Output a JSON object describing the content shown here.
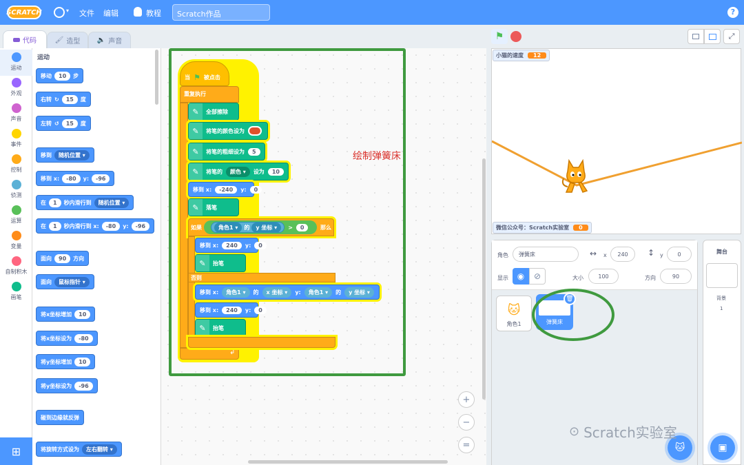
{
  "menu": {
    "logo": "SCRATCH",
    "file": "文件",
    "edit": "编辑",
    "tutorials": "教程",
    "project_title": "Scratch作品",
    "help": "?"
  },
  "tabs": {
    "code": "代码",
    "costumes": "造型",
    "sounds": "声音"
  },
  "categories": [
    {
      "label": "运动",
      "color": "#4c97ff"
    },
    {
      "label": "外观",
      "color": "#9966ff"
    },
    {
      "label": "声音",
      "color": "#cf63cf"
    },
    {
      "label": "事件",
      "color": "#ffd500"
    },
    {
      "label": "控制",
      "color": "#ffab19"
    },
    {
      "label": "侦测",
      "color": "#5cb1d6"
    },
    {
      "label": "运算",
      "color": "#59c059"
    },
    {
      "label": "变量",
      "color": "#ff8c1a"
    },
    {
      "label": "自制积木",
      "color": "#ff6680"
    },
    {
      "label": "画笔",
      "color": "#0fbd8c"
    }
  ],
  "palette": {
    "section": "运动",
    "move": {
      "pre": "移动",
      "val": "10",
      "post": "步"
    },
    "turn_right": {
      "pre": "右转",
      "val": "15",
      "post": "度"
    },
    "turn_left": {
      "pre": "左转",
      "val": "15",
      "post": "度"
    },
    "goto_random": {
      "pre": "移到",
      "drop": "随机位置"
    },
    "goto_xy": {
      "pre": "移到 x:",
      "x": "-80",
      "ylab": "y:",
      "y": "-96"
    },
    "glide_random": {
      "pre": "在",
      "val": "1",
      "mid": "秒内滑行到",
      "drop": "随机位置"
    },
    "glide_xy": {
      "pre": "在",
      "val": "1",
      "mid": "秒内滑行到 x:",
      "x": "-80",
      "ylab": "y:",
      "y": "-96"
    },
    "point_dir": {
      "pre": "面向",
      "val": "90",
      "post": "方向"
    },
    "point_towards": {
      "pre": "面向",
      "drop": "鼠标指针"
    },
    "change_x": {
      "pre": "将x坐标增加",
      "val": "10"
    },
    "set_x": {
      "pre": "将x坐标设为",
      "val": "-80"
    },
    "change_y": {
      "pre": "将y坐标增加",
      "val": "10"
    },
    "set_y": {
      "pre": "将y坐标设为",
      "val": "-96"
    },
    "bounce": "碰到边缘就反弹",
    "rotation": {
      "pre": "将旋转方式设为",
      "drop": "左右翻转"
    }
  },
  "script": {
    "hat": {
      "pre": "当",
      "post": "被点击"
    },
    "forever": "重复执行",
    "erase": "全部擦除",
    "set_color": "将笔的颜色设为",
    "set_size": {
      "label": "将笔的粗细设为",
      "val": "5"
    },
    "set_param": {
      "pre": "将笔的",
      "drop": "颜色",
      "mid": "设为",
      "val": "10"
    },
    "goto1": {
      "pre": "移到 x:",
      "x": "-240",
      "ylab": "y:",
      "y": "0"
    },
    "pen_down": "落笔",
    "if": {
      "pre": "如果",
      "sprite": "角色1",
      "of": "的",
      "attr": "y 坐标",
      "op": ">",
      "val": "0",
      "then": "那么"
    },
    "goto2": {
      "pre": "移到 x:",
      "x": "240",
      "ylab": "y:",
      "y": "0"
    },
    "pen_up1": "抬笔",
    "else": "否则",
    "goto3": {
      "pre": "移到 x:",
      "sprite1": "角色1",
      "of1": "的",
      "attr1": "x 坐标",
      "ylab": "y:",
      "sprite2": "角色1",
      "of2": "的",
      "attr2": "y 坐标"
    },
    "goto4": {
      "pre": "移到 x:",
      "x": "240",
      "ylab": "y:",
      "y": "0"
    },
    "pen_up2": "抬笔",
    "pen_color_hex": "#e0522c"
  },
  "annotation": "绘制弹簧床",
  "zoom": {
    "in": "+",
    "out": "−",
    "reset": "="
  },
  "stage": {
    "monitor1": {
      "label": "小猫的速度",
      "value": "12"
    },
    "monitor2": {
      "label": "微信公众号：Scratch实验室",
      "value": "0"
    },
    "line_color": "#f0a030"
  },
  "sprite_info": {
    "sprite_label": "角色",
    "sprite_name": "弹簧床",
    "x_label": "x",
    "x": "240",
    "y_label": "y",
    "y": "0",
    "show_label": "显示",
    "size_label": "大小",
    "size": "100",
    "direction_label": "方向",
    "direction": "90"
  },
  "sprites": [
    {
      "name": "角色1",
      "selected": false
    },
    {
      "name": "弹簧床",
      "selected": true
    }
  ],
  "stage_pane": {
    "title": "舞台",
    "backdrops_label": "背景",
    "backdrops_count": "1"
  },
  "watermark": "Scratch实验室"
}
